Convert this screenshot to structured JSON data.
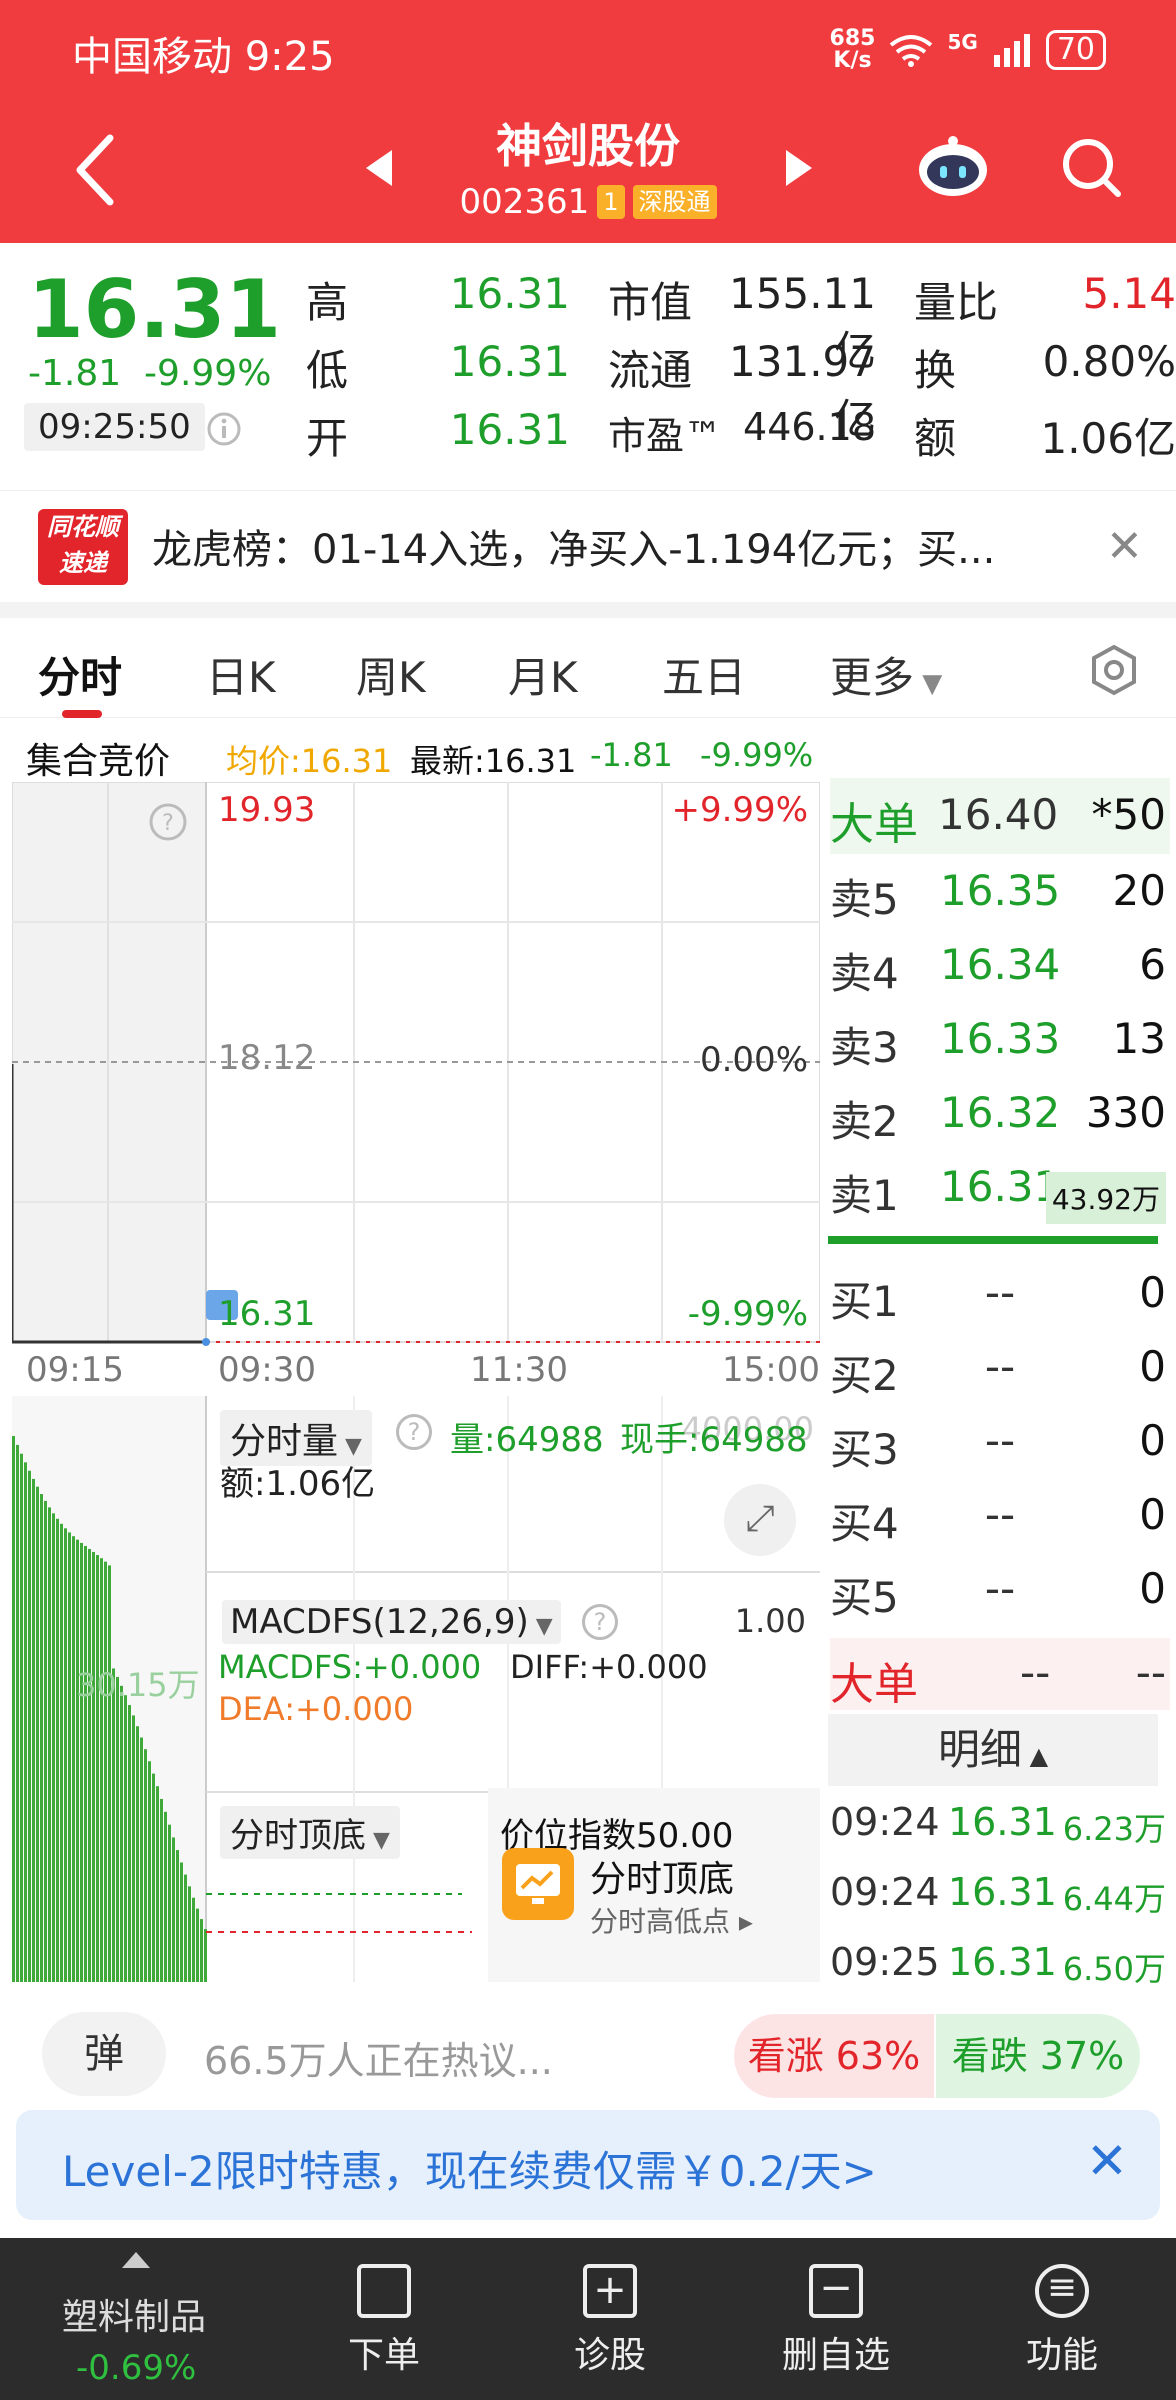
{
  "status": {
    "carrier_time": "中国移动 9:25",
    "net_speed_top": "685",
    "net_speed_unit": "K/s",
    "signal_label": "5G",
    "battery": "70"
  },
  "header": {
    "stock_name": "神剑股份",
    "stock_code": "002361",
    "tag1": "1",
    "tag2": "深股通"
  },
  "quote": {
    "price": "16.31",
    "change": "-1.81",
    "change_pct": "-9.99%",
    "time": "09:25:50",
    "high_label": "高",
    "high": "16.31",
    "low_label": "低",
    "low": "16.31",
    "open_label": "开",
    "open": "16.31",
    "mktcap_label": "市值",
    "mktcap": "155.11亿",
    "float_label": "流通",
    "float": "131.97亿",
    "pe_label": "市盈™",
    "pe": "446.18",
    "vol_ratio_label": "量比",
    "vol_ratio": "5.14",
    "turnover_label": "换",
    "turnover": "0.80%",
    "amount_label": "额",
    "amount": "1.06亿"
  },
  "news": {
    "logo_line1": "同花顺",
    "logo_line2": "速递",
    "text": "龙虎榜：01-14入选，净买入-1.194亿元；买..."
  },
  "tabs": [
    "分时",
    "日K",
    "周K",
    "月K",
    "五日",
    "更多"
  ],
  "infoline": {
    "label": "集合竞价",
    "avg": "均价:16.31",
    "latest": "最新:16.31",
    "chg": "-1.81",
    "pct": "-9.99%"
  },
  "chart": {
    "y_top": "19.93",
    "y_mid": "18.12",
    "y_bot": "16.31",
    "pct_top": "+9.99%",
    "pct_mid": "0.00%",
    "pct_bot": "-9.99%",
    "x_pre": "09:15",
    "x_labels": [
      "09:30",
      "11:30",
      "15:00"
    ],
    "vol_title": "分时量",
    "vol_value": "量:64988",
    "vol_now": "现手:64988",
    "vol_amount": "额:1.06亿",
    "vol_axis_top": "4000.00",
    "vol_axis_mid": "30.15万",
    "macd_title": "MACDFS(12,26,9)",
    "macd_axis": "1.00",
    "macd_val": "MACDFS:+0.000",
    "diff_val": "DIFF:+0.000",
    "dea_val": "DEA:+0.000",
    "indicator_title": "分时顶底",
    "indicator_idx": "价位指数50.00",
    "popup_title": "分时顶底",
    "popup_sub": "分时高低点"
  },
  "book": {
    "big_label": "大单",
    "big_price": "16.40",
    "big_vol": "*50",
    "asks": [
      {
        "label": "卖5",
        "price": "16.35",
        "vol": "20"
      },
      {
        "label": "卖4",
        "price": "16.34",
        "vol": "6"
      },
      {
        "label": "卖3",
        "price": "16.33",
        "vol": "13"
      },
      {
        "label": "卖2",
        "price": "16.32",
        "vol": "330"
      },
      {
        "label": "卖1",
        "price": "16.31",
        "vol": "43.92万"
      }
    ],
    "bids": [
      {
        "label": "买1",
        "price": "--",
        "vol": "0"
      },
      {
        "label": "买2",
        "price": "--",
        "vol": "0"
      },
      {
        "label": "买3",
        "price": "--",
        "vol": "0"
      },
      {
        "label": "买4",
        "price": "--",
        "vol": "0"
      },
      {
        "label": "买5",
        "price": "--",
        "vol": "0"
      }
    ],
    "big2_label": "大单",
    "big2_price": "--",
    "big2_vol": "--",
    "detail_label": "明细",
    "trades": [
      {
        "time": "09:24",
        "price": "16.31",
        "vol": "6.23万"
      },
      {
        "time": "09:24",
        "price": "16.31",
        "vol": "6.44万"
      },
      {
        "time": "09:25",
        "price": "16.31",
        "vol": "6.50万"
      }
    ]
  },
  "hot": {
    "danmu": "弹",
    "text": "66.5万人正在热议...",
    "up": "看涨 63%",
    "down": "看跌 37%"
  },
  "promo": {
    "text": "Level-2限时特惠，现在续费仅需￥0.2/天>"
  },
  "nav": {
    "sector": "塑料制品",
    "sector_chg": "-0.69%",
    "items": [
      "下单",
      "诊股",
      "删自选",
      "功能"
    ]
  },
  "colors": {
    "header_red": "#f03c3f",
    "down_green": "#1e9e2a",
    "up_red": "#e2252b"
  }
}
